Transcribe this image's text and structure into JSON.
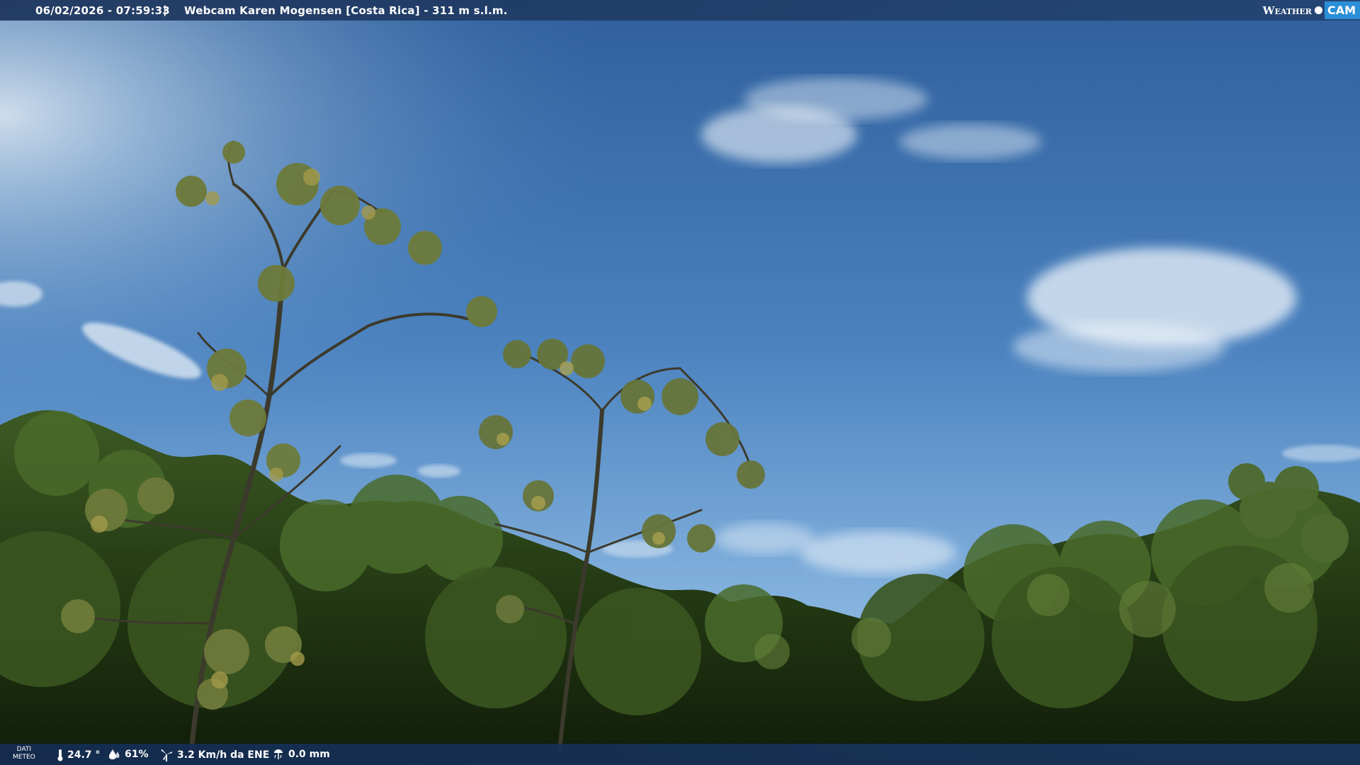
{
  "header": {
    "datetime": "06/02/2026 - 07:59:33",
    "separator": "|",
    "title": "Webcam Karen Mogensen [Costa Rica]  - 311 m s.l.m."
  },
  "logo": {
    "word1": "Weather",
    "word2": "CAM"
  },
  "footer": {
    "label_line1": "DATI",
    "label_line2": "METEO",
    "temperature": "24.7 °",
    "humidity": "61%",
    "wind": "3.2 Km/h da ENE",
    "rain": "0.0 mm"
  },
  "colors": {
    "sky_top": "#2f5f9c",
    "sky_bottom": "#7fb0dc",
    "bar_bg": "#1c345c",
    "logo_accent": "#2a8fd6"
  },
  "icons": {
    "temperature": "thermometer-icon",
    "humidity": "water-drop-icon",
    "wind": "wind-turbine-icon",
    "rain": "rain-gauge-icon"
  }
}
